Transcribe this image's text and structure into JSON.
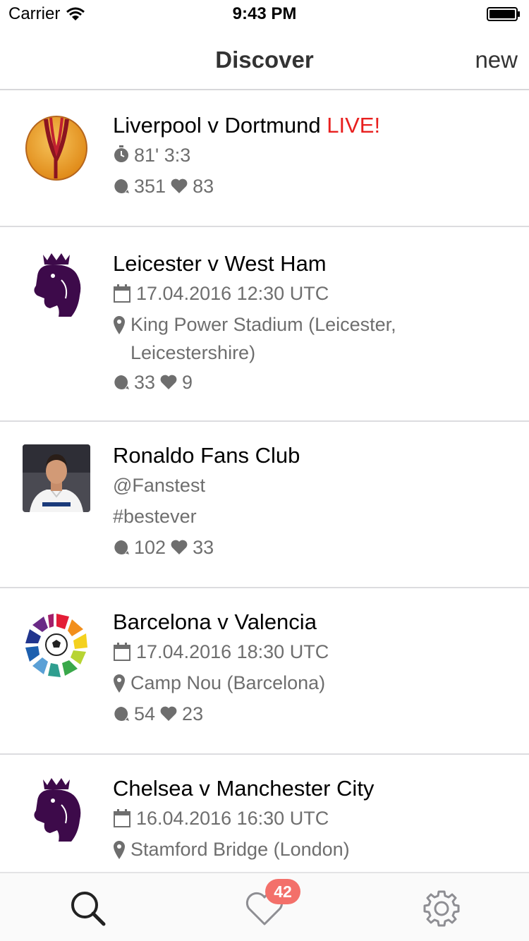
{
  "status_bar": {
    "carrier": "Carrier",
    "time": "9:43 PM"
  },
  "nav": {
    "title": "Discover",
    "new_label": "new"
  },
  "feed": [
    {
      "title": "Liverpool v Dortmund",
      "live_label": "LIVE!",
      "timer": "81' 3:3",
      "comments": "351",
      "likes": "83",
      "thumb": "europa-league-logo"
    },
    {
      "title": "Leicester v West Ham",
      "date": "17.04.2016 12:30 UTC",
      "location": "King Power Stadium (Leicester, Leicestershire)",
      "comments": "33",
      "likes": "9",
      "thumb": "premier-league-logo"
    },
    {
      "title": "Ronaldo Fans Club",
      "handle": "@Fanstest",
      "tag": "#bestever",
      "comments": "102",
      "likes": "33",
      "thumb": "profile-photo"
    },
    {
      "title": "Barcelona v Valencia",
      "date": "17.04.2016 18:30 UTC",
      "location": "Camp Nou (Barcelona)",
      "comments": "54",
      "likes": "23",
      "thumb": "la-liga-logo"
    },
    {
      "title": "Chelsea v Manchester City",
      "date": "16.04.2016 16:30 UTC",
      "location": "Stamford Bridge (London)",
      "thumb": "premier-league-logo"
    }
  ],
  "tab_bar": {
    "tabs": [
      "search-icon",
      "heart-icon",
      "gear-icon"
    ],
    "favorites_badge": "42"
  },
  "colors": {
    "live": "#e8201f",
    "badge": "#f3706a",
    "premier_league": "#3d0a4a",
    "meta_text": "#6e6e6e"
  }
}
